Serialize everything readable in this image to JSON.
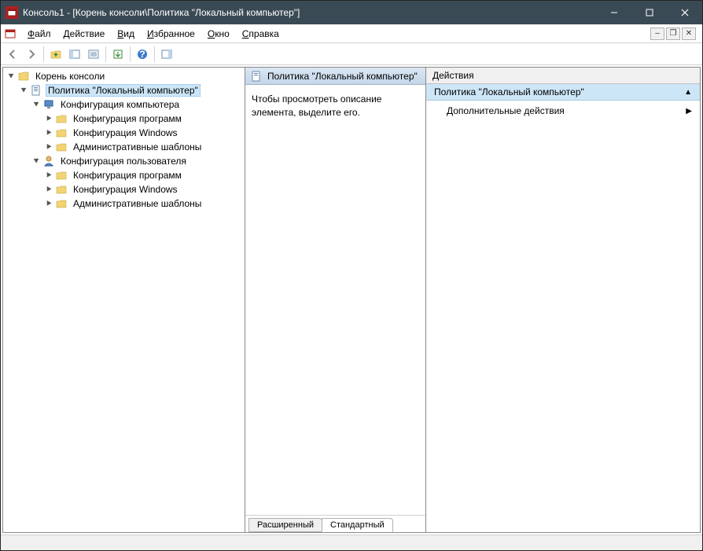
{
  "title": "Консоль1 - [Корень консоли\\Политика \"Локальный компьютер\"]",
  "menu": {
    "file": "Файл",
    "action": "Действие",
    "view": "Вид",
    "favorites": "Избранное",
    "window": "Окно",
    "help": "Справка"
  },
  "tree": {
    "root": "Корень консоли",
    "policy": "Политика \"Локальный компьютер\"",
    "comp_config": "Конфигурация компьютера",
    "sw_config": "Конфигурация программ",
    "win_config": "Конфигурация Windows",
    "admin_templates": "Административные шаблоны",
    "user_config": "Конфигурация пользователя"
  },
  "middle": {
    "header": "Политика \"Локальный компьютер\"",
    "body": "Чтобы просмотреть описание элемента, выделите его.",
    "tab_extended": "Расширенный",
    "tab_standard": "Стандартный"
  },
  "actions": {
    "title": "Действия",
    "sub": "Политика \"Локальный компьютер\"",
    "more": "Дополнительные действия"
  }
}
